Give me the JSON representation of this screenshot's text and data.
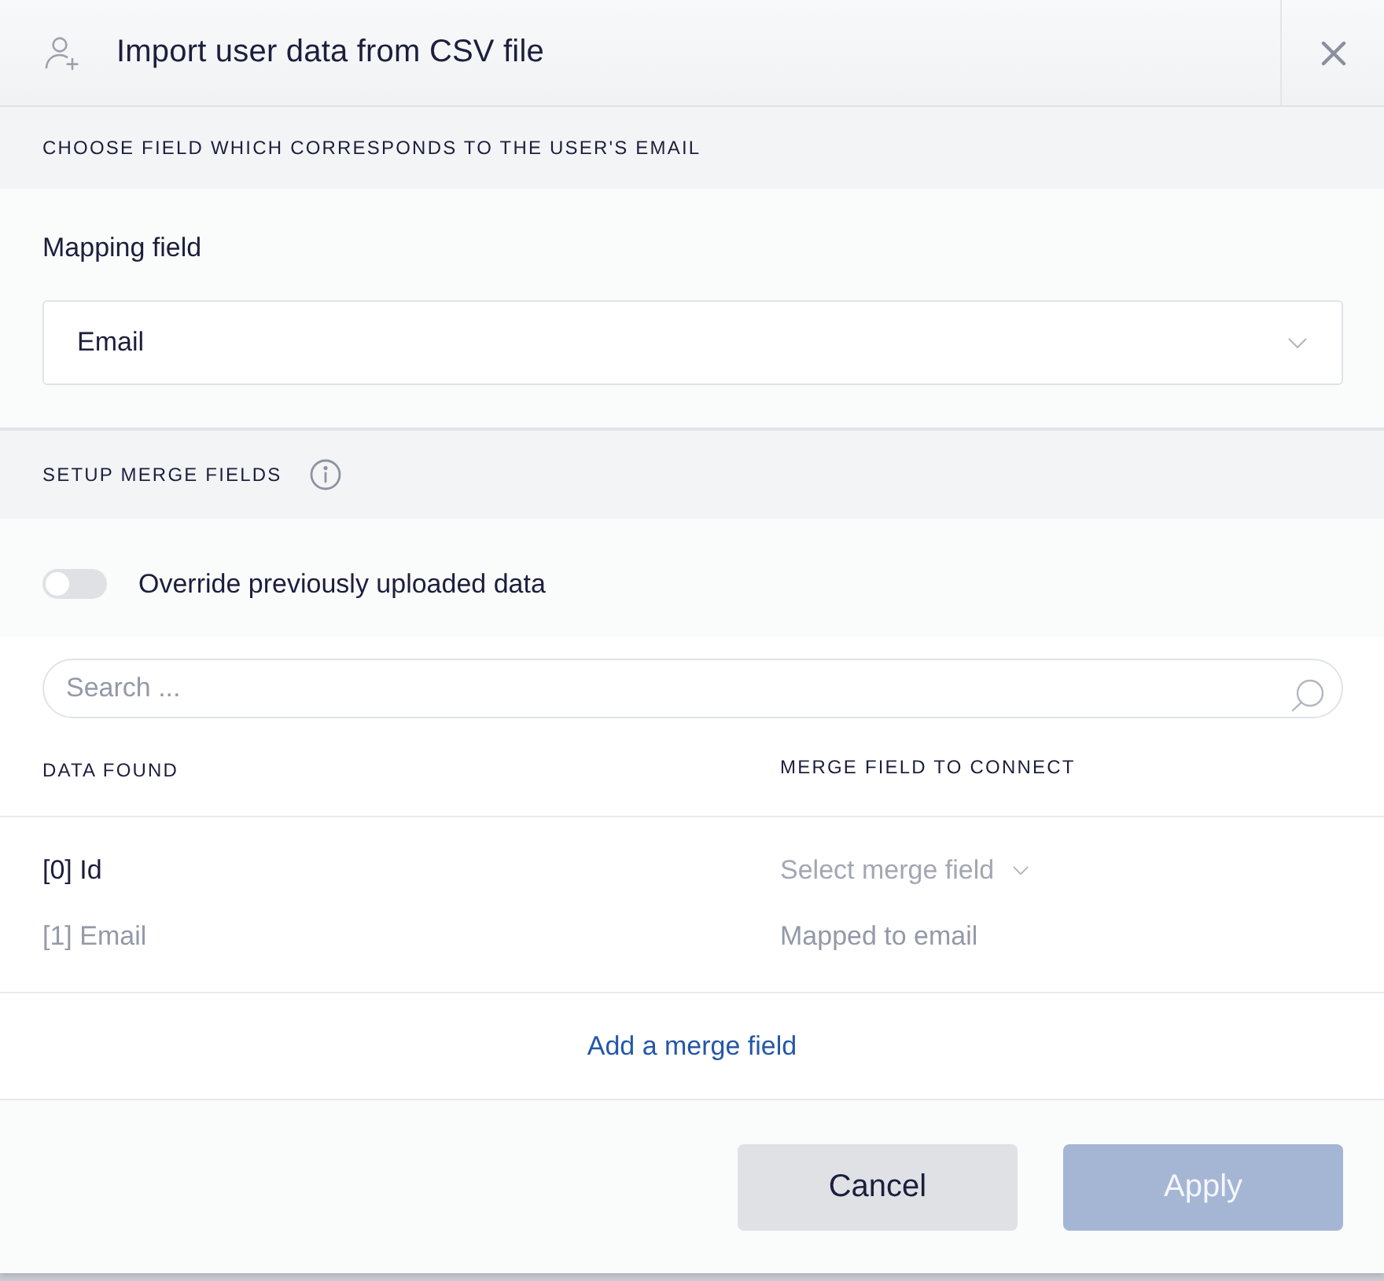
{
  "window": {
    "title": "Import user data from CSV file"
  },
  "mapping_section": {
    "heading": "CHOOSE FIELD WHICH CORRESPONDS TO THE USER'S EMAIL",
    "field_label": "Mapping field",
    "select": {
      "value": "Email"
    }
  },
  "merge_section": {
    "heading": "SETUP MERGE FIELDS",
    "override_toggle": {
      "label": "Override previously uploaded data",
      "on": false
    },
    "search": {
      "placeholder": "Search ..."
    },
    "table": {
      "columns": [
        "DATA FOUND",
        "MERGE FIELD TO CONNECT"
      ],
      "rows": [
        {
          "data": "[0] Id",
          "disabled": false,
          "merge_field": {
            "kind": "select",
            "placeholder": "Select merge field"
          }
        },
        {
          "data": "[1] Email",
          "disabled": true,
          "merge_field": {
            "kind": "text",
            "text": "Mapped to email"
          }
        }
      ]
    },
    "add_link": "Add a merge field"
  },
  "buttons": [
    {
      "label": "Cancel",
      "kind": "secondary",
      "disabled": false
    },
    {
      "label": "Apply",
      "kind": "primary",
      "disabled": true
    }
  ]
}
